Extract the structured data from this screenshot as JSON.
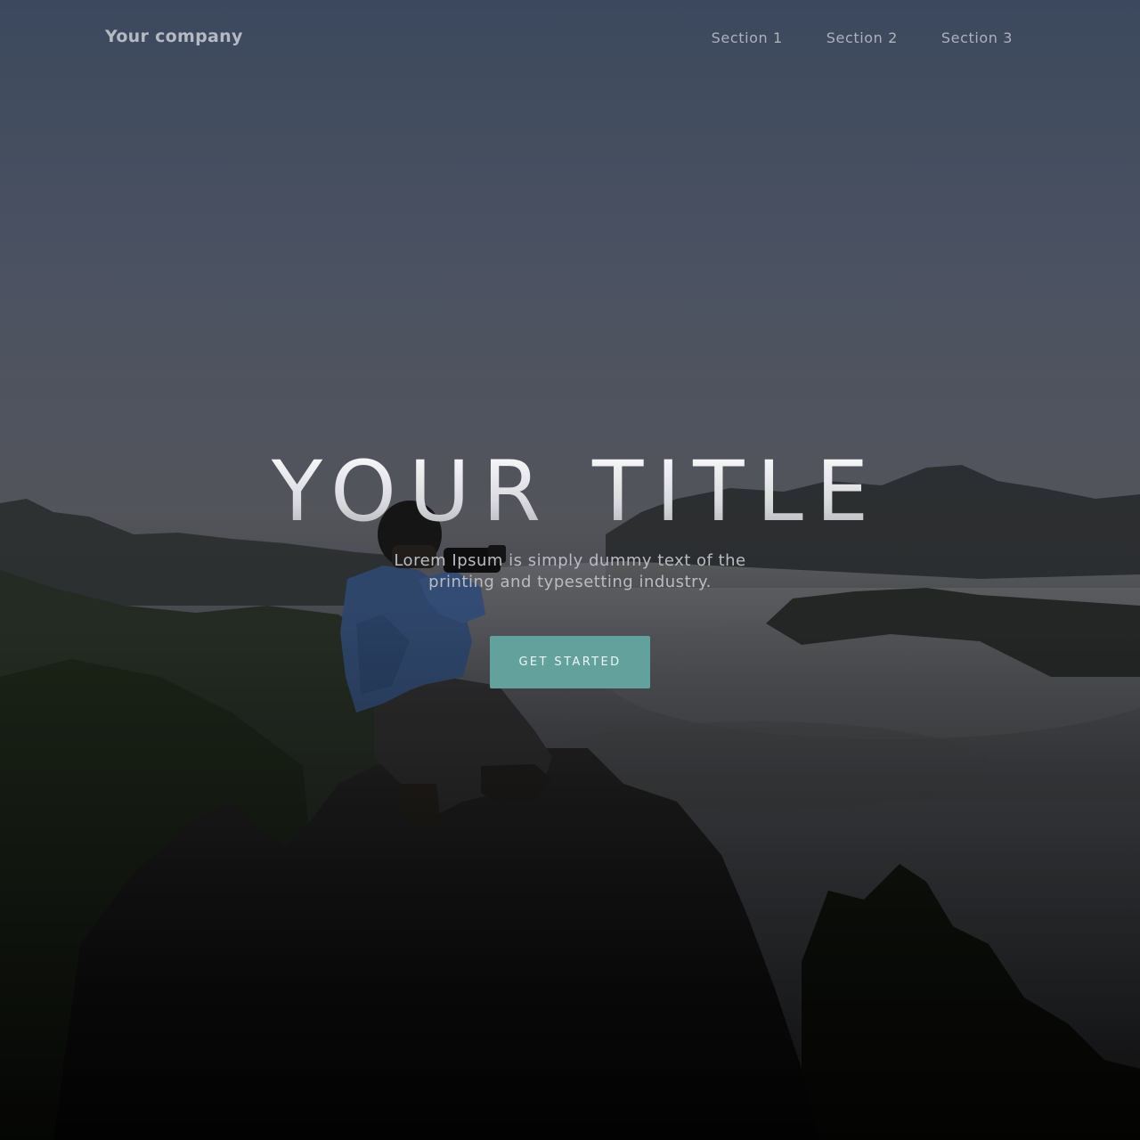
{
  "header": {
    "brand": "Your company",
    "nav": [
      {
        "label": "Section 1"
      },
      {
        "label": "Section 2"
      },
      {
        "label": "Section 3"
      }
    ]
  },
  "hero": {
    "title": "YOUR TITLE",
    "subtitle": "Lorem Ipsum is simply dummy text of the printing and typesetting industry.",
    "cta_label": "GET STARTED"
  },
  "colors": {
    "accent": "#62a19c",
    "sky_top": "#44536a",
    "sky_bottom": "#6b6f78",
    "overlay": "#0b0b0c"
  },
  "background": {
    "icon": "photographer-on-mountain-image"
  }
}
